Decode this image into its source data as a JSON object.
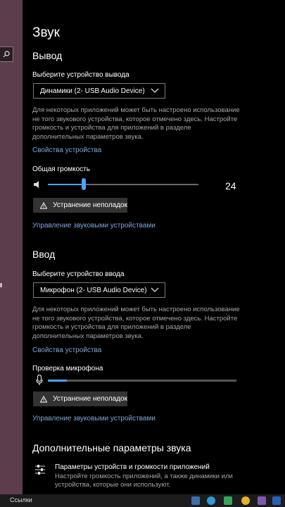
{
  "header": {
    "title": "Звук"
  },
  "output": {
    "heading": "Вывод",
    "device_label": "Выберите устройство вывода",
    "device_value": "Динамики (2- USB Audio Device)",
    "description": "Для некоторых приложений может быть настроено использование не того звукового устройства, которое отмечено здесь. Настройте громкость и устройства для приложений в разделе дополнительных параметров звука.",
    "properties_link": "Свойства устройства",
    "volume_label": "Общая громкость",
    "volume_value": "24",
    "volume_level": 0.24,
    "troubleshoot_button": "Устранение неполадок",
    "manage_link": "Управление звуковыми устройствами"
  },
  "input": {
    "heading": "Ввод",
    "device_label": "Выберите устройство ввода",
    "device_value": "Микрофон (2- USB Audio Device)",
    "description": "Для некоторых приложений может быть настроено использование не того звукового устройства, которое отмечено здесь. Настройте громкость и устройства для приложений в разделе дополнительных параметров звука.",
    "properties_link": "Свойства устройства",
    "mic_test_label": "Проверка микрофона",
    "mic_level": 0.1,
    "troubleshoot_button": "Устранение неполадок",
    "manage_link": "Управление звуковыми устройствами"
  },
  "advanced": {
    "heading": "Дополнительные параметры звука",
    "item_title": "Параметры устройств и громкости приложений",
    "item_description": "Настройте громкость приложений, а также динамики или устройства, которые они используют."
  },
  "taskbar": {
    "links_label": "Ссылки"
  },
  "colors": {
    "accent": "#4ea1ff",
    "link": "#7aa7d6",
    "sidebar": "#5c3d4b"
  }
}
